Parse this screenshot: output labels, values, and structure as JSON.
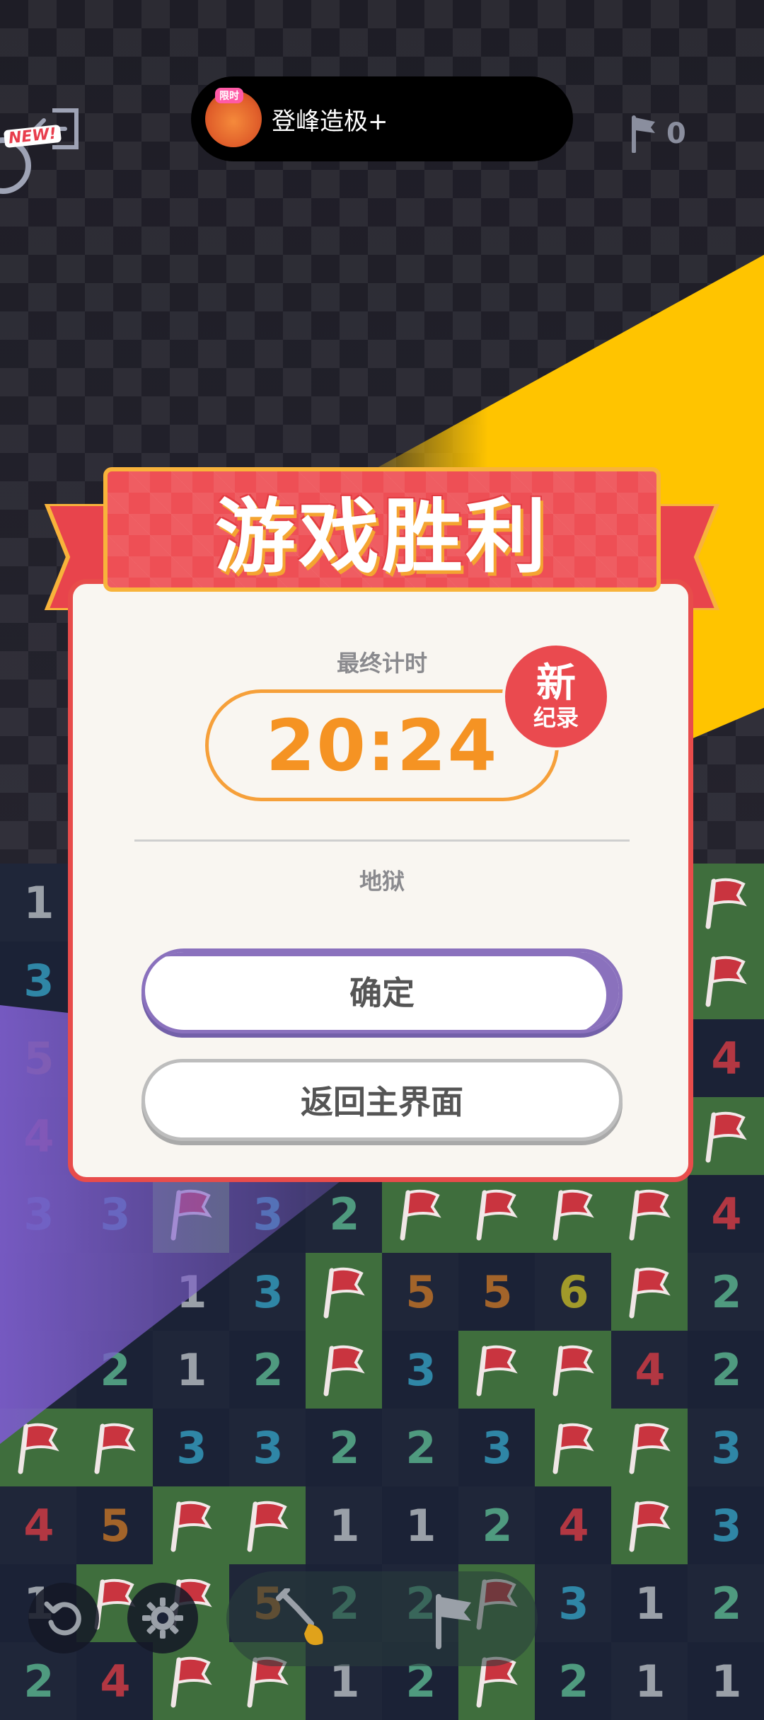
{
  "top_bar": {
    "island_badge_text": "限时",
    "island_text": "登峰造极+",
    "new_tag": "NEW!",
    "flag_count": "0"
  },
  "dialog": {
    "title": "游戏胜利",
    "final_time_label": "最终计时",
    "time": "20:24",
    "new_record_big": "新",
    "new_record_small": "纪录",
    "difficulty": "地狱",
    "confirm_button": "确定",
    "home_button": "返回主界面"
  },
  "board": {
    "rows": [
      [
        "1",
        "",
        "",
        "",
        "",
        "",
        "",
        "",
        "",
        "F"
      ],
      [
        "3",
        "",
        "",
        "",
        "",
        "",
        "",
        "",
        "",
        "F"
      ],
      [
        "5",
        "",
        "",
        "",
        "",
        "",
        "",
        "",
        "",
        "4"
      ],
      [
        "4",
        "",
        "",
        "",
        "",
        "",
        "",
        "",
        "",
        "F"
      ],
      [
        "3",
        "3",
        "F",
        "3",
        "2",
        "F",
        "F",
        "F",
        "F",
        "4"
      ],
      [
        "",
        "",
        "1",
        "3",
        "F",
        "5",
        "5",
        "6",
        "F",
        "2"
      ],
      [
        "",
        "2",
        "1",
        "2",
        "F",
        "3",
        "F",
        "F",
        "4",
        "2"
      ],
      [
        "F",
        "F",
        "3",
        "3",
        "2",
        "2",
        "3",
        "F",
        "F",
        "3"
      ],
      [
        "4",
        "5",
        "F",
        "F",
        "1",
        "1",
        "2",
        "4",
        "F",
        "3"
      ],
      [
        "1",
        "F",
        "F",
        "5",
        "2",
        "2",
        "F",
        "3",
        "1",
        "2"
      ],
      [
        "2",
        "4",
        "F",
        "F",
        "1",
        "2",
        "F",
        "2",
        "1",
        "1"
      ]
    ],
    "green_cells": [
      [
        0,
        9
      ],
      [
        1,
        9
      ],
      [
        3,
        9
      ],
      [
        4,
        2
      ],
      [
        4,
        5
      ],
      [
        4,
        6
      ],
      [
        4,
        7
      ],
      [
        4,
        8
      ],
      [
        5,
        4
      ],
      [
        5,
        8
      ],
      [
        6,
        4
      ],
      [
        6,
        6
      ],
      [
        6,
        7
      ],
      [
        7,
        0
      ],
      [
        7,
        1
      ],
      [
        7,
        7
      ],
      [
        7,
        8
      ],
      [
        8,
        2
      ],
      [
        8,
        3
      ],
      [
        8,
        8
      ],
      [
        9,
        1
      ],
      [
        9,
        2
      ],
      [
        9,
        6
      ],
      [
        10,
        2
      ],
      [
        10,
        3
      ],
      [
        10,
        6
      ]
    ],
    "number_colors": {
      "1": "#9aa0a8",
      "2": "#4f9a7f",
      "3": "#2f86a6",
      "4": "#b23742",
      "5": "#a3642a",
      "6": "#a19a2a"
    }
  },
  "colors": {
    "accent_red": "#e84c4b",
    "timer_orange": "#f59323",
    "confirm_purple": "#8a71bd",
    "yellow_band": "#ffc400"
  }
}
